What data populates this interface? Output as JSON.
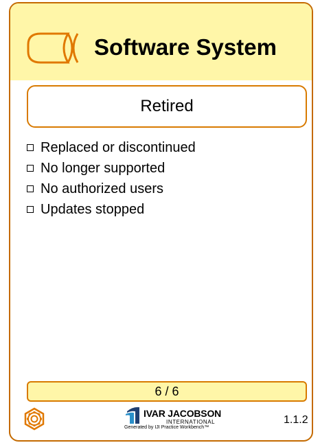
{
  "card": {
    "title": "Software System",
    "state": "Retired",
    "checklist": [
      "Replaced or discontinued",
      "No longer supported",
      "No authorized users",
      "Updates stopped"
    ],
    "progress": "6 / 6",
    "version": "1.1.2"
  },
  "logo": {
    "brand": "IVAR JACOBSON",
    "sub": "INTERNATIONAL",
    "generated": "Generated by IJI Practice Workbench™"
  },
  "icons": {
    "alpha": "alpha-symbol-icon",
    "gear": "gear-icon",
    "logo": "iji-logo-icon"
  },
  "colors": {
    "header_bg": "#fff6a8",
    "accent": "#d87a00",
    "progress_bg": "#fff6a8"
  }
}
